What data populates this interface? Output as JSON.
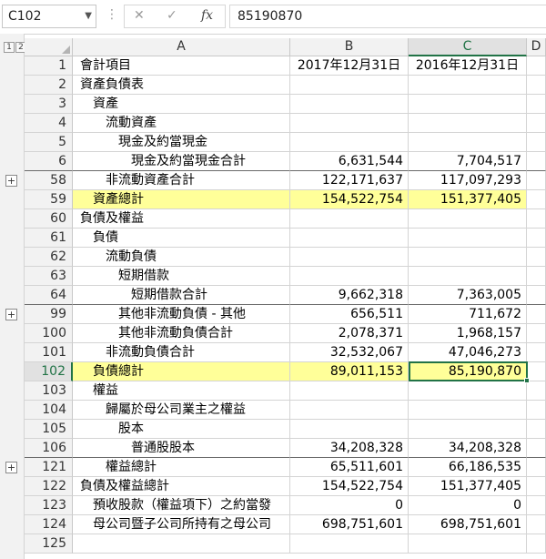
{
  "formula_bar": {
    "name_box": "C102",
    "cancel_symbol": "✕",
    "enter_symbol": "✓",
    "fx_symbol": "fx",
    "formula_value": "85190870"
  },
  "outline": {
    "level_buttons": [
      "1",
      "2"
    ]
  },
  "columns": [
    {
      "label": "A",
      "active": false
    },
    {
      "label": "B",
      "active": false
    },
    {
      "label": "C",
      "active": true
    },
    {
      "label": "D",
      "active": false
    }
  ],
  "rows": [
    {
      "num": "1",
      "a": "會計項目",
      "b": "2017年12月31日",
      "c": "2016年12月31日",
      "align_bc": "center"
    },
    {
      "num": "2",
      "a": "資產負債表",
      "b": "",
      "c": ""
    },
    {
      "num": "3",
      "a": "　資產",
      "b": "",
      "c": ""
    },
    {
      "num": "4",
      "a": "　　流動資產",
      "b": "",
      "c": ""
    },
    {
      "num": "5",
      "a": "　　　現金及約當現金",
      "b": "",
      "c": ""
    },
    {
      "num": "6",
      "a": "　　　　現金及約當現金合計",
      "b": "6,631,544",
      "c": "7,704,517",
      "plus_after": true
    },
    {
      "num": "58",
      "a": "　　非流動資產合計",
      "b": "122,171,637",
      "c": "117,097,293"
    },
    {
      "num": "59",
      "a": "　資產總計",
      "b": "154,522,754",
      "c": "151,377,405",
      "highlight": true
    },
    {
      "num": "60",
      "a": "負債及權益",
      "b": "",
      "c": ""
    },
    {
      "num": "61",
      "a": "　負債",
      "b": "",
      "c": ""
    },
    {
      "num": "62",
      "a": "　　流動負債",
      "b": "",
      "c": ""
    },
    {
      "num": "63",
      "a": "　　　短期借款",
      "b": "",
      "c": ""
    },
    {
      "num": "64",
      "a": "　　　　短期借款合計",
      "b": "9,662,318",
      "c": "7,363,005",
      "plus_after": true
    },
    {
      "num": "99",
      "a": "　　　其他非流動負債 - 其他",
      "b": "656,511",
      "c": "711,672"
    },
    {
      "num": "100",
      "a": "　　　其他非流動負債合計",
      "b": "2,078,371",
      "c": "1,968,157"
    },
    {
      "num": "101",
      "a": "　　非流動負債合計",
      "b": "32,532,067",
      "c": "47,046,273"
    },
    {
      "num": "102",
      "a": "　負債總計",
      "b": "89,011,153",
      "c": "85,190,870",
      "highlight": true,
      "active": true
    },
    {
      "num": "103",
      "a": "　權益",
      "b": "",
      "c": ""
    },
    {
      "num": "104",
      "a": "　　歸屬於母公司業主之權益",
      "b": "",
      "c": ""
    },
    {
      "num": "105",
      "a": "　　　股本",
      "b": "",
      "c": ""
    },
    {
      "num": "106",
      "a": "　　　　普通股股本",
      "b": "34,208,328",
      "c": "34,208,328",
      "plus_after": true
    },
    {
      "num": "121",
      "a": "　　權益總計",
      "b": "65,511,601",
      "c": "66,186,535"
    },
    {
      "num": "122",
      "a": "負債及權益總計",
      "b": "154,522,754",
      "c": "151,377,405"
    },
    {
      "num": "123",
      "a": "　預收股款（權益項下）之約當發",
      "b": "0",
      "c": "0"
    },
    {
      "num": "124",
      "a": "　母公司暨子公司所持有之母公司",
      "b": "698,751,601",
      "c": "698,751,601"
    },
    {
      "num": "125",
      "a": "",
      "b": "",
      "c": ""
    }
  ],
  "colors": {
    "highlight": "#ffff99",
    "selection": "#217346",
    "header_bg": "#f2f2f2"
  }
}
